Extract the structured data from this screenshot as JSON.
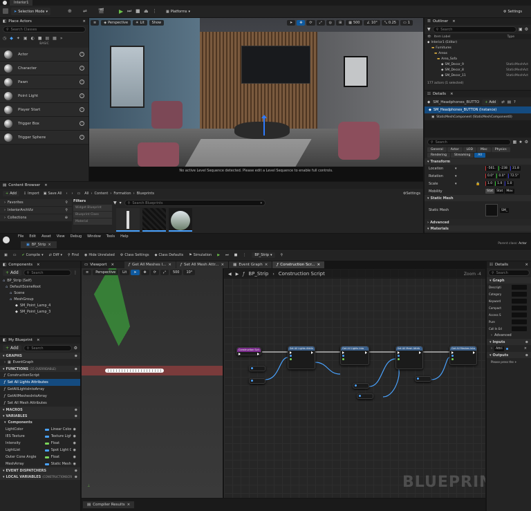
{
  "top_editor": {
    "tab_title": "Interior1",
    "toolbar": {
      "mode_label": "Selection Mode",
      "platforms_label": "Platforms",
      "settings_label": "Settings"
    },
    "place_actors": {
      "title": "Place Actors",
      "search_placeholder": "Search Classes",
      "category_label": "BASIC",
      "items": [
        "Actor",
        "Character",
        "Pawn",
        "Point Light",
        "Player Start",
        "Trigger Box",
        "Trigger Sphere"
      ]
    },
    "viewport": {
      "perspective_label": "Perspective",
      "lit_label": "Lit",
      "show_label": "Show",
      "snap_value": "500",
      "angle_value": "10°",
      "scale_value": "0.25",
      "camera_value": "1",
      "message": "No active Level Sequence detected. Please edit a Level Sequence to enable full controls."
    },
    "outliner": {
      "title": "Outliner",
      "search_placeholder": "Search",
      "col_item": "Item Label",
      "col_type": "Type",
      "items": [
        {
          "label": "Interior1 (Editor)",
          "type": ""
        },
        {
          "label": "Furnitures",
          "type": ""
        },
        {
          "label": "Areas",
          "type": ""
        },
        {
          "label": "Area_Sofa",
          "type": ""
        },
        {
          "label": "SM_Decor_9",
          "type": "StaticMeshAct"
        },
        {
          "label": "SM_Decor_8",
          "type": "StaticMeshAct"
        },
        {
          "label": "SM_Decor_11",
          "type": "StaticMeshAct"
        }
      ],
      "footer": "177 actors (1 selected)"
    },
    "details": {
      "title": "Details",
      "object_name": "SM_Headphones_BUTTO",
      "add_label": "Add",
      "instance_label": "SM_Headphones_BUTTON (Instance)",
      "component_label": "StaticMeshComponent (StaticMeshComponent0)",
      "search_placeholder": "Search",
      "filter_tabs": [
        "General",
        "Actor",
        "LOD",
        "Misc",
        "Physics",
        "Rendering",
        "Streaming",
        "All"
      ],
      "transform_label": "Transform",
      "location_label": "Location",
      "location_values": [
        "-561.",
        "-238",
        "31.8"
      ],
      "rotation_label": "Rotation",
      "rotation_values": [
        "0.0°",
        "0.0°",
        "72.5°"
      ],
      "scale_label": "Scale",
      "scale_values": [
        "1.0",
        "1.0",
        "1.0"
      ],
      "mobility_label": "Mobility",
      "mobility_options": [
        "Stat",
        "Stat",
        "Mov"
      ],
      "static_mesh_section": "Static Mesh",
      "static_mesh_label": "Static Mesh",
      "static_mesh_value": "SM_",
      "advanced_label": "Advanced",
      "materials_label": "Materials"
    },
    "content_browser": {
      "title": "Content Browser",
      "add_label": "Add",
      "import_label": "Import",
      "save_all_label": "Save All",
      "path": [
        "All",
        "Content",
        "Formation",
        "Blueprints"
      ],
      "settings_label": "Settings",
      "favorites_label": "Favorites",
      "project_label": "InteriorArchViz",
      "collections_label": "Collections",
      "filters_label": "Filters",
      "filter_items": [
        "Widget Blueprint",
        "Blueprint Class",
        "Material"
      ],
      "search_placeholder": "Search Blueprints"
    }
  },
  "blueprint_editor": {
    "tab_title": "BP_Strip",
    "parent_class_label": "Parent class:",
    "parent_class_value": "Actor",
    "menu": [
      "File",
      "Edit",
      "Asset",
      "View",
      "Debug",
      "Window",
      "Tools",
      "Help"
    ],
    "toolbar": {
      "compile_label": "Compile",
      "diff_label": "Diff",
      "find_label": "Find",
      "hide_unrelated_label": "Hide Unrelated",
      "class_settings_label": "Class Settings",
      "class_defaults_label": "Class Defaults",
      "simulation_label": "Simulation",
      "debug_target": "BP_Strip"
    },
    "components": {
      "title": "Components",
      "add_label": "Add",
      "search_placeholder": "Search",
      "items": [
        "BP_Strip (Self)",
        "DefaultSceneRoot",
        "Scene",
        "MeshGroup",
        "SM_Point_Lamp_4",
        "SM_Point_Lamp_3"
      ]
    },
    "my_blueprint": {
      "title": "My Blueprint",
      "add_label": "Add",
      "search_placeholder": "Search",
      "graphs_label": "GRAPHS",
      "graph_items": [
        "EventGraph"
      ],
      "functions_label": "FUNCTIONS",
      "functions_count": "(15 OVERRIDABLE)",
      "function_items": [
        "ConstructionScript",
        "Set All Lights Attributes",
        "GetAllLightsIntoArray",
        "GetAllMeshesIntoArray",
        "Set All Mesh Attributes"
      ],
      "macros_label": "MACROS",
      "variables_label": "VARIABLES",
      "components_label": "Components",
      "variable_items": [
        {
          "name": "LightColor",
          "type": "Linear Color",
          "color": "#4aa3ff"
        },
        {
          "name": "IES Texture",
          "type": "Texture Ligh",
          "color": "#4aa3ff"
        },
        {
          "name": "Intensity",
          "type": "Float",
          "color": "#7bd65a"
        },
        {
          "name": "LightList",
          "type": "Spot Light C",
          "color": "#4aa3ff"
        },
        {
          "name": "Outer Cone Angle",
          "type": "Float",
          "color": "#7bd65a"
        },
        {
          "name": "MeshArray",
          "type": "Static Mesh",
          "color": "#4aa3ff"
        }
      ],
      "event_dispatchers_label": "EVENT DISPATCHERS",
      "local_variables_label": "LOCAL VARIABLES",
      "local_variables_scope": "(CONSTRUCTIONSCRI"
    },
    "viewport": {
      "title": "Viewport",
      "perspective_label": "Perspective",
      "lit_label": "Lit",
      "snap_value": "500",
      "angle_value": "10°"
    },
    "graph_tabs": [
      "Get All Meshes I...",
      "Set All Mesh Attr...",
      "Event Graph",
      "Construction Scr..."
    ],
    "graph": {
      "breadcrumb_root": "BP_Strip",
      "breadcrumb_leaf": "Construction Script",
      "zoom_label": "Zoom -4",
      "watermark": "BLUEPRINT",
      "nodes": [
        {
          "title": "Construction Script",
          "color": "#7a2b8c"
        },
        {
          "title": "Set All Lights Attrib",
          "color": "#3a5f8a"
        },
        {
          "title": "Get All Lights Into",
          "color": "#3a5f8a"
        },
        {
          "title": "Set All Mesh Attrib",
          "color": "#3a5f8a"
        },
        {
          "title": "Get All Meshes Into",
          "color": "#3a5f8a"
        }
      ]
    },
    "details": {
      "title": "Details",
      "search_placeholder": "Search",
      "graph_label": "Graph",
      "fields": [
        "Descripti",
        "Category",
        "Keyword",
        "Compact",
        "Access S",
        "Pure",
        "Call In Ed"
      ],
      "advanced_label": "Advanced",
      "inputs_label": "Inputs",
      "input_name": "Attri",
      "outputs_label": "Outputs",
      "outputs_hint": "Please press the +"
    },
    "compiler_results_label": "Compiler Results"
  }
}
